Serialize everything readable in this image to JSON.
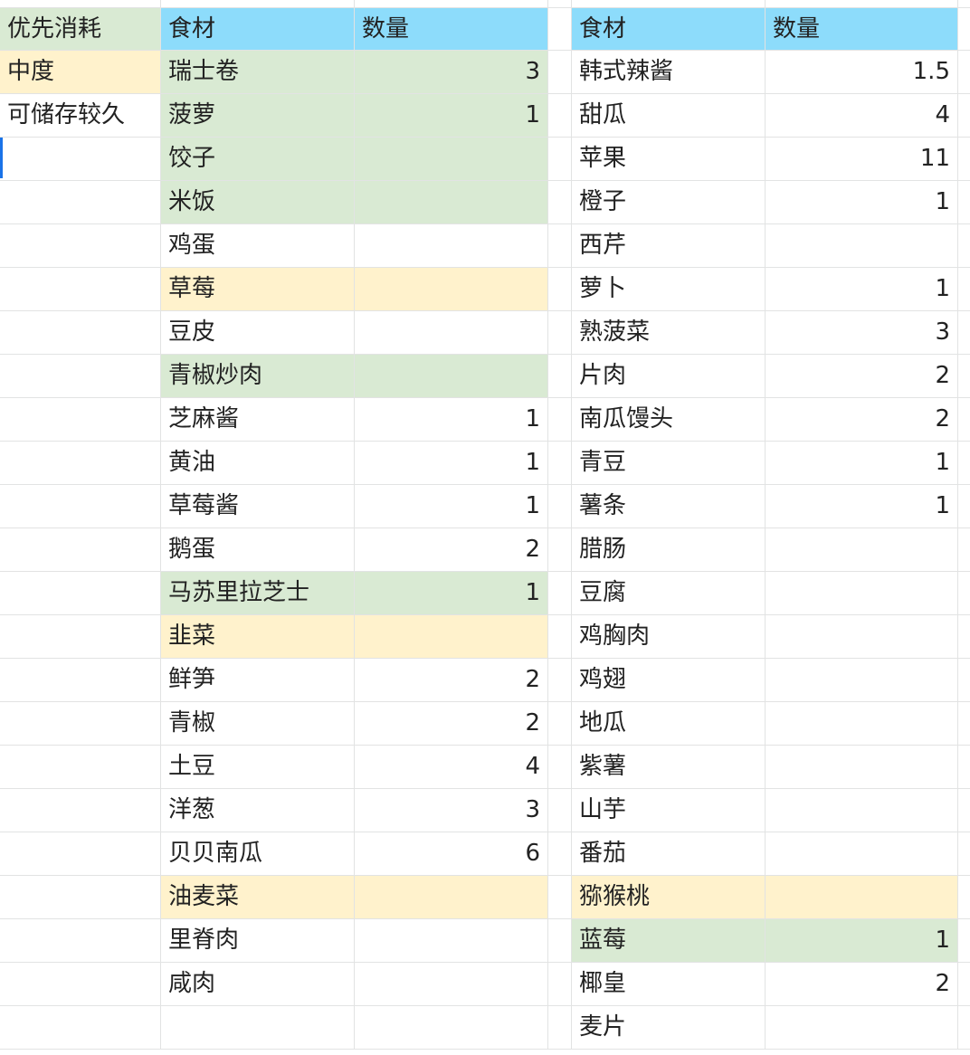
{
  "legend": {
    "header": "优先消耗",
    "items": [
      "中度",
      "可储存较久"
    ]
  },
  "tables": [
    {
      "headers": [
        "食材",
        "数量"
      ],
      "rows": [
        {
          "name": "瑞士卷",
          "qty": "3",
          "color": "green"
        },
        {
          "name": "菠萝",
          "qty": "1",
          "color": "green"
        },
        {
          "name": "饺子",
          "qty": "",
          "color": "green"
        },
        {
          "name": "米饭",
          "qty": "",
          "color": "green"
        },
        {
          "name": "鸡蛋",
          "qty": "",
          "color": ""
        },
        {
          "name": "草莓",
          "qty": "",
          "color": "yellow"
        },
        {
          "name": "豆皮",
          "qty": "",
          "color": ""
        },
        {
          "name": "青椒炒肉",
          "qty": "",
          "color": "green"
        },
        {
          "name": "芝麻酱",
          "qty": "1",
          "color": ""
        },
        {
          "name": "黄油",
          "qty": "1",
          "color": ""
        },
        {
          "name": "草莓酱",
          "qty": "1",
          "color": ""
        },
        {
          "name": "鹅蛋",
          "qty": "2",
          "color": ""
        },
        {
          "name": "马苏里拉芝士",
          "qty": "1",
          "color": "green"
        },
        {
          "name": "韭菜",
          "qty": "",
          "color": "yellow"
        },
        {
          "name": "鲜笋",
          "qty": "2",
          "color": ""
        },
        {
          "name": "青椒",
          "qty": "2",
          "color": ""
        },
        {
          "name": "土豆",
          "qty": "4",
          "color": ""
        },
        {
          "name": "洋葱",
          "qty": "3",
          "color": ""
        },
        {
          "name": "贝贝南瓜",
          "qty": "6",
          "color": ""
        },
        {
          "name": "油麦菜",
          "qty": "",
          "color": "yellow"
        },
        {
          "name": "里脊肉",
          "qty": "",
          "color": ""
        },
        {
          "name": "咸肉",
          "qty": "",
          "color": ""
        },
        {
          "name": "",
          "qty": "",
          "color": ""
        }
      ]
    },
    {
      "headers": [
        "食材",
        "数量"
      ],
      "rows": [
        {
          "name": "韩式辣酱",
          "qty": "1.5",
          "color": ""
        },
        {
          "name": "甜瓜",
          "qty": "4",
          "color": ""
        },
        {
          "name": "苹果",
          "qty": "11",
          "color": ""
        },
        {
          "name": "橙子",
          "qty": "1",
          "color": ""
        },
        {
          "name": "西芹",
          "qty": "",
          "color": ""
        },
        {
          "name": "萝卜",
          "qty": "1",
          "color": ""
        },
        {
          "name": "熟菠菜",
          "qty": "3",
          "color": ""
        },
        {
          "name": "片肉",
          "qty": "2",
          "color": ""
        },
        {
          "name": "南瓜馒头",
          "qty": "2",
          "color": ""
        },
        {
          "name": "青豆",
          "qty": "1",
          "color": ""
        },
        {
          "name": "薯条",
          "qty": "1",
          "color": ""
        },
        {
          "name": "腊肠",
          "qty": "",
          "color": ""
        },
        {
          "name": "豆腐",
          "qty": "",
          "color": ""
        },
        {
          "name": "鸡胸肉",
          "qty": "",
          "color": ""
        },
        {
          "name": "鸡翅",
          "qty": "",
          "color": ""
        },
        {
          "name": "地瓜",
          "qty": "",
          "color": ""
        },
        {
          "name": "紫薯",
          "qty": "",
          "color": ""
        },
        {
          "name": "山芋",
          "qty": "",
          "color": ""
        },
        {
          "name": "番茄",
          "qty": "",
          "color": ""
        },
        {
          "name": "猕猴桃",
          "qty": "",
          "color": "yellow"
        },
        {
          "name": "蓝莓",
          "qty": "1",
          "color": "green"
        },
        {
          "name": "椰皇",
          "qty": "2",
          "color": ""
        },
        {
          "name": "麦片",
          "qty": "",
          "color": ""
        }
      ]
    }
  ],
  "colors": {
    "header": "#8ddcfb",
    "green": "#d9ead3",
    "yellow": "#fff2cc",
    "gridline": "#e2e3e3",
    "cursor": "#1a73e8"
  }
}
